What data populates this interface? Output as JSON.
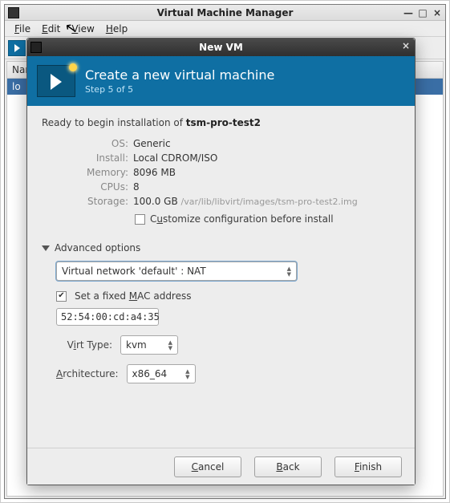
{
  "bg": {
    "title": "Virtual Machine Manager",
    "menu": {
      "file": "File",
      "edit": "Edit",
      "view": "View",
      "help": "Help"
    },
    "column_header": "Nam",
    "row0": "lo"
  },
  "modal": {
    "title": "New VM",
    "banner_title": "Create a new virtual machine",
    "banner_sub": "Step 5 of 5"
  },
  "summary": {
    "intro_prefix": "Ready to begin installation of ",
    "intro_name": "tsm-pro-test2",
    "labels": {
      "os": "OS:",
      "install": "Install:",
      "memory": "Memory:",
      "cpus": "CPUs:",
      "storage": "Storage:"
    },
    "os": "Generic",
    "install": "Local CDROM/ISO",
    "memory": "8096 MB",
    "cpus": "8",
    "storage_main": "100.0 GB",
    "storage_path": "/var/lib/libvirt/images/tsm-pro-test2.img",
    "customize_label": "Customize configuration before install",
    "customize_checked": false
  },
  "advanced": {
    "header": "Advanced options",
    "network": "Virtual network 'default' : NAT",
    "fixed_mac_label": "Set a fixed MAC address",
    "fixed_mac_checked": true,
    "mac": "52:54:00:cd:a4:35",
    "virt_type_label": "Virt Type:",
    "virt_type": "kvm",
    "arch_label": "Architecture:",
    "arch": "x86_64"
  },
  "buttons": {
    "cancel": "Cancel",
    "back": "Back",
    "finish": "Finish"
  }
}
